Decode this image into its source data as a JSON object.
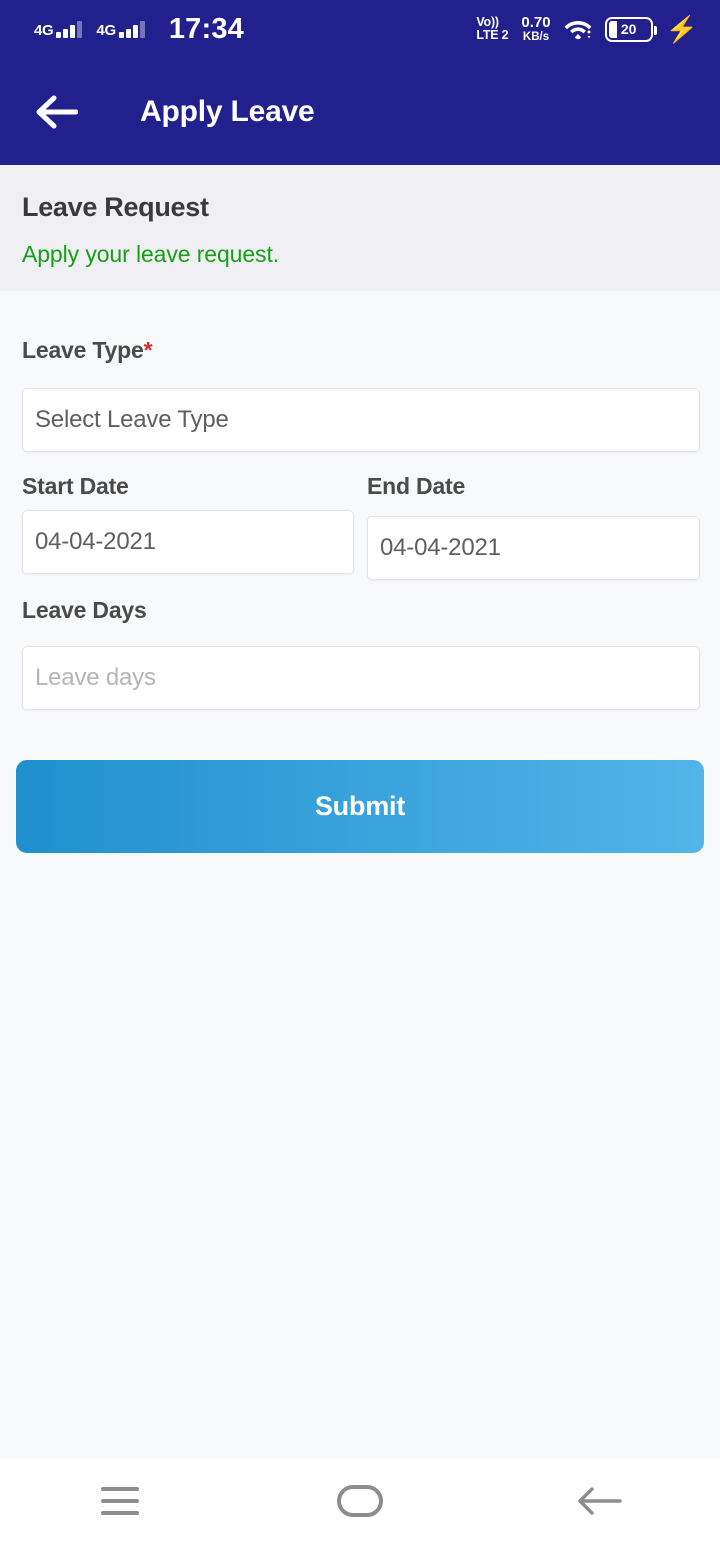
{
  "status_bar": {
    "network_1": "4G",
    "network_2": "4G",
    "time": "17:34",
    "volte_line1": "Vo))",
    "volte_line2": "LTE 2",
    "net_rate": "0.70",
    "net_unit": "KB/s",
    "wifi_icon": "wifi-icon",
    "battery_level": "20",
    "charging_icon": "lightning-bolt-icon"
  },
  "app_bar": {
    "back_icon": "back-arrow-icon",
    "title": "Apply Leave"
  },
  "header_card": {
    "title": "Leave Request",
    "subtitle": "Apply your leave request.",
    "subtitle_color": "#16a017",
    "background_color": "#f0eff4"
  },
  "form": {
    "leave_type": {
      "label": "Leave Type",
      "required_marker": "*",
      "placeholder": "Select Leave Type",
      "value": ""
    },
    "start_date": {
      "label": "Start Date",
      "value": "04-04-2021"
    },
    "end_date": {
      "label": "End Date",
      "value": "04-04-2021"
    },
    "leave_days": {
      "label": "Leave Days",
      "placeholder": "Leave days",
      "value": ""
    },
    "submit_label": "Submit",
    "submit_gradient_from": "#1f90ce",
    "submit_gradient_to": "#53b4e9"
  },
  "nav_bar": {
    "recents_icon": "hamburger-recents-icon",
    "home_icon": "home-pill-icon",
    "back_icon": "nav-back-arrow-icon"
  },
  "theme": {
    "header_navy": "#21208c",
    "page_background": "#f8f9fa",
    "required_red": "#d32f2f"
  }
}
